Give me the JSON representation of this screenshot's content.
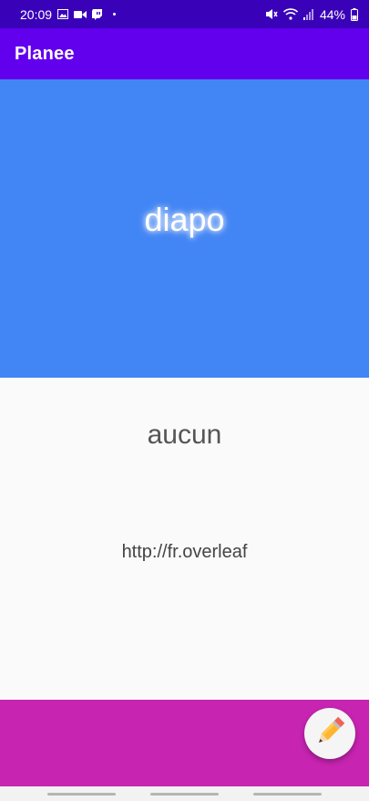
{
  "status_bar": {
    "time": "20:09",
    "battery": "44%",
    "icons_left": [
      "gallery-icon",
      "video-icon",
      "twitch-icon"
    ],
    "icons_right": [
      "mute-icon",
      "wifi-icon",
      "signal-icon",
      "battery-icon"
    ]
  },
  "app_bar": {
    "title": "Planee",
    "color": "#6200ee"
  },
  "card": {
    "title": "diapo",
    "color": "#4285f4"
  },
  "content": {
    "heading": "aucun",
    "link": "http://fr.overleaf"
  },
  "bottom_band": {
    "color": "#c724b1"
  },
  "fab": {
    "icon": "pencil-icon"
  }
}
